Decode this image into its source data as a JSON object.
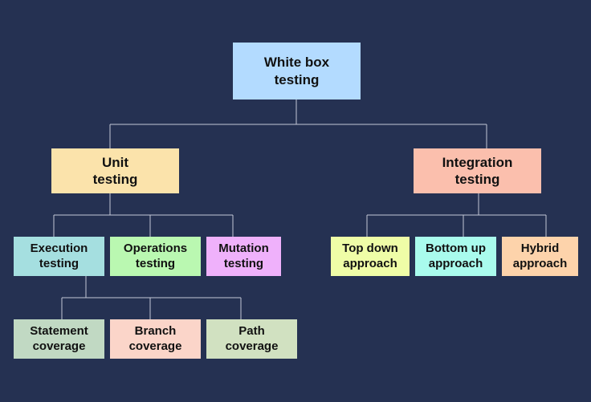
{
  "diagram": {
    "root": {
      "line1": "White box",
      "line2": "testing",
      "color": "#b3dbff"
    },
    "unit": {
      "line1": "Unit",
      "line2": "testing",
      "color": "#fbe3ab"
    },
    "integration": {
      "line1": "Integration",
      "line2": "testing",
      "color": "#fbbfad"
    },
    "execution": {
      "line1": "Execution",
      "line2": "testing",
      "color": "#a5dfe0"
    },
    "operations": {
      "line1": "Operations",
      "line2": "testing",
      "color": "#baf8b1"
    },
    "mutation": {
      "line1": "Mutation",
      "line2": "testing",
      "color": "#efb1fb"
    },
    "statement": {
      "line1": "Statement",
      "line2": "coverage",
      "color": "#c1d9c3"
    },
    "branch": {
      "line1": "Branch",
      "line2": "coverage",
      "color": "#fbd5c9"
    },
    "path": {
      "line1": "Path",
      "line2": "coverage",
      "color": "#d1e1c1"
    },
    "topdown": {
      "line1": "Top down",
      "line2": "approach",
      "color": "#effda7"
    },
    "bottomup": {
      "line1": "Bottom up",
      "line2": "approach",
      "color": "#a9fbed"
    },
    "hybrid": {
      "line1": "Hybrid",
      "line2": "approach",
      "color": "#fdd3ab"
    }
  }
}
